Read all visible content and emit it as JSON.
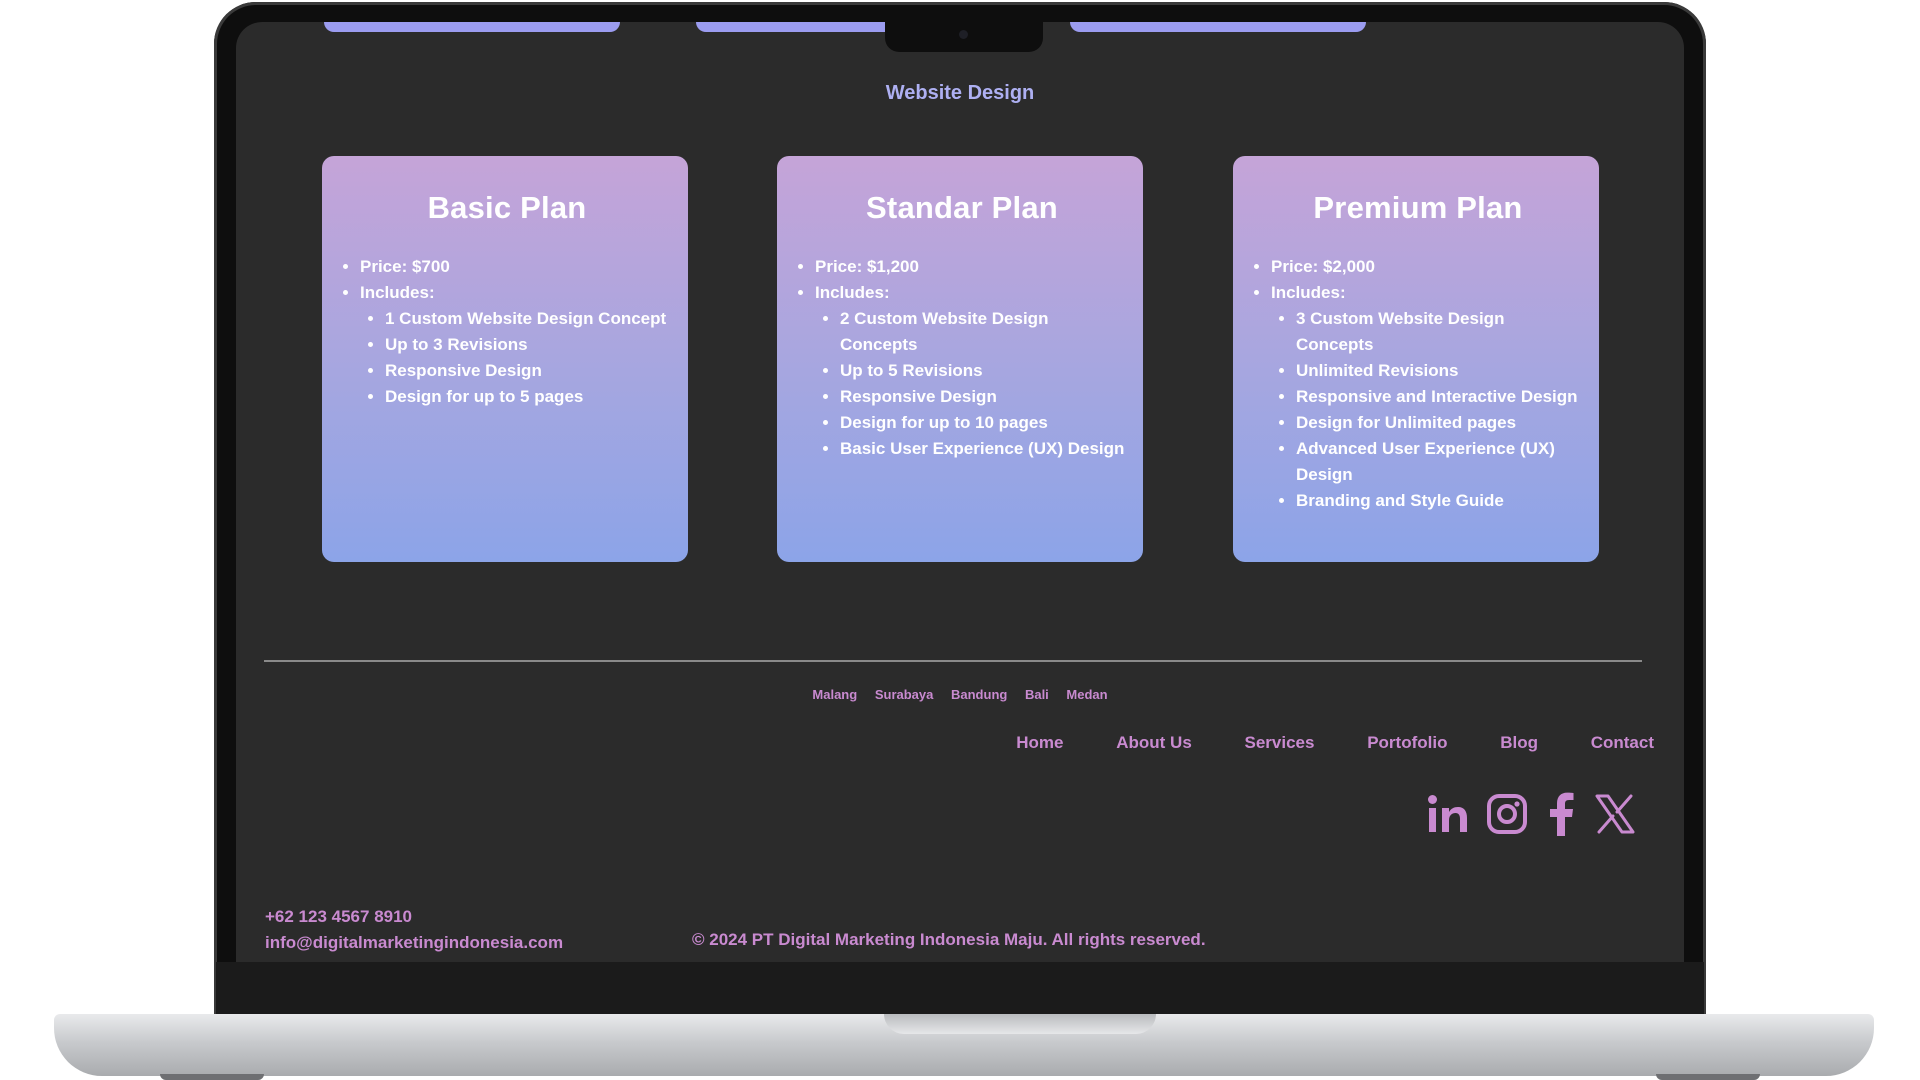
{
  "section_title": "Website Design",
  "plans": [
    {
      "name": "Basic Plan",
      "price": "Price: $700",
      "includes_label": "Includes:",
      "includes": [
        "1 Custom Website Design Concept",
        "Up to 3 Revisions",
        "Responsive Design",
        "Design for up to 5 pages"
      ]
    },
    {
      "name": "Standar Plan",
      "price": "Price: $1,200",
      "includes_label": "Includes:",
      "includes": [
        "2 Custom Website Design Concepts",
        "Up to 5 Revisions",
        "Responsive Design",
        "Design for up to 10 pages",
        "Basic User Experience (UX) Design"
      ]
    },
    {
      "name": "Premium Plan",
      "price": "Price: $2,000",
      "includes_label": "Includes:",
      "includes": [
        "3 Custom Website Design Concepts",
        "Unlimited Revisions",
        "Responsive and Interactive Design",
        "Design for Unlimited pages",
        "Advanced User Experience (UX) Design",
        "Branding and Style Guide"
      ]
    }
  ],
  "footer": {
    "cities": [
      "Malang",
      "Surabaya",
      "Bandung",
      "Bali",
      "Medan"
    ],
    "nav": [
      "Home",
      "About Us",
      "Services",
      "Portofolio",
      "Blog",
      "Contact"
    ],
    "social_icons": [
      "linkedin-icon",
      "instagram-icon",
      "facebook-icon",
      "x-icon"
    ],
    "phone": "+62 123 4567 8910",
    "email": "info@digitalmarketingindonesia.com",
    "copyright": "© 2024 PT Digital Marketing Indonesia Maju. All rights reserved."
  },
  "colors": {
    "screen_bg": "#2b2b2b",
    "accent_pink": "#c98ad0",
    "card_top": "#c5a4d8",
    "card_bottom": "#8ca4e8",
    "title_lavender": "#aeb0f2"
  }
}
